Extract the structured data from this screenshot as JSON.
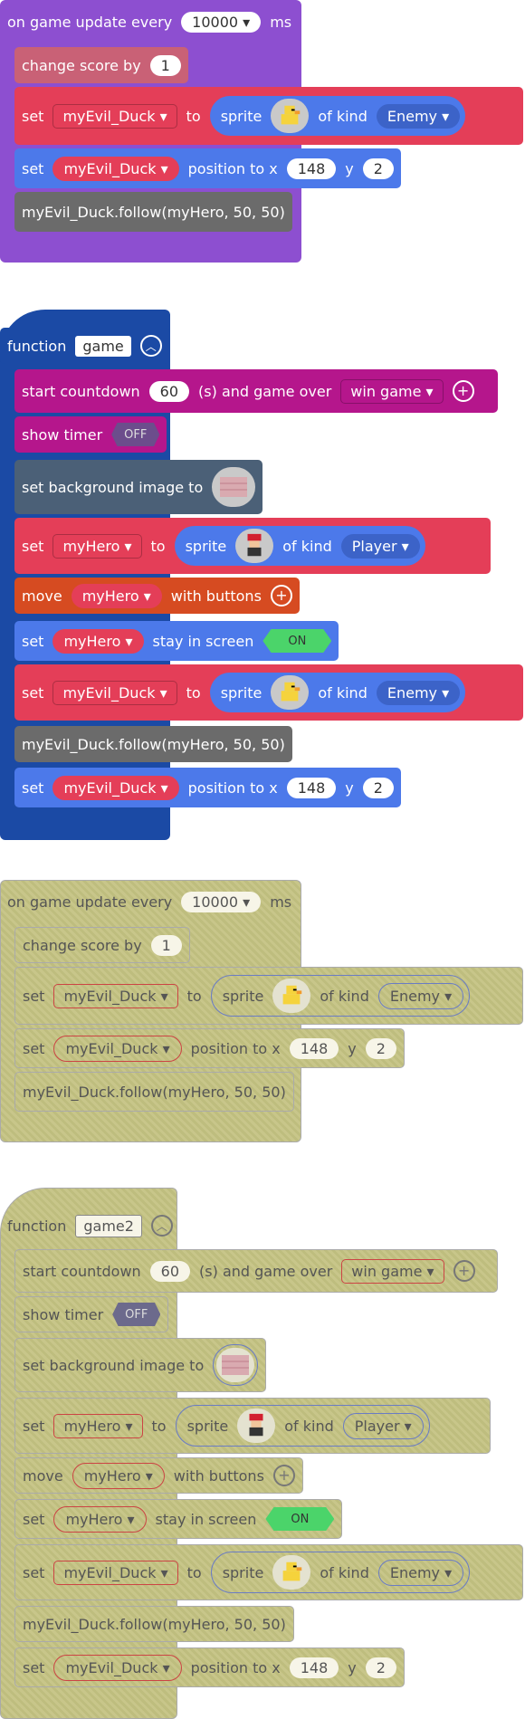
{
  "colors": {
    "events": "#8d4fd0",
    "info": "#c96176",
    "sprites": "#e43e58",
    "spriteKind": "#4c79ea",
    "code": "#6b6b6b",
    "functions": "#1b4aa5",
    "game": "#b5168c",
    "scene": "#4b6077",
    "controller": "#d64b21"
  },
  "blocks": {
    "update_label": "on game update every",
    "update_ms_value": "10000",
    "update_ms_unit": "ms",
    "change_score_label": "change score by",
    "change_score_value": "1",
    "set_label": "set",
    "to_label": "to",
    "sprite_label": "sprite",
    "of_kind_label": "of kind",
    "kind_enemy": "Enemy",
    "kind_player": "Player",
    "evil_duck": "myEvil_Duck",
    "my_hero": "myHero",
    "position_label": "position to x",
    "x_value": "148",
    "y_label": "y",
    "y_value": "2",
    "follow_code": "myEvil_Duck.follow(myHero, 50, 50)",
    "function_label": "function",
    "function_name_1": "game",
    "function_name_2": "game2",
    "countdown_label": "start countdown",
    "countdown_value": "60",
    "countdown_rest": "(s) and game over",
    "win_game": "win game",
    "show_timer_label": "show timer",
    "off_label": "OFF",
    "on_label": "ON",
    "bg_label": "set background image to",
    "move_label": "move",
    "with_buttons_label": "with buttons",
    "stay_label": "stay in screen"
  },
  "icons": [
    "chevron-down-icon",
    "plus-circle-icon",
    "collapse-up-icon",
    "duck-sprite-icon",
    "hero-sprite-icon",
    "brick-background-icon"
  ]
}
